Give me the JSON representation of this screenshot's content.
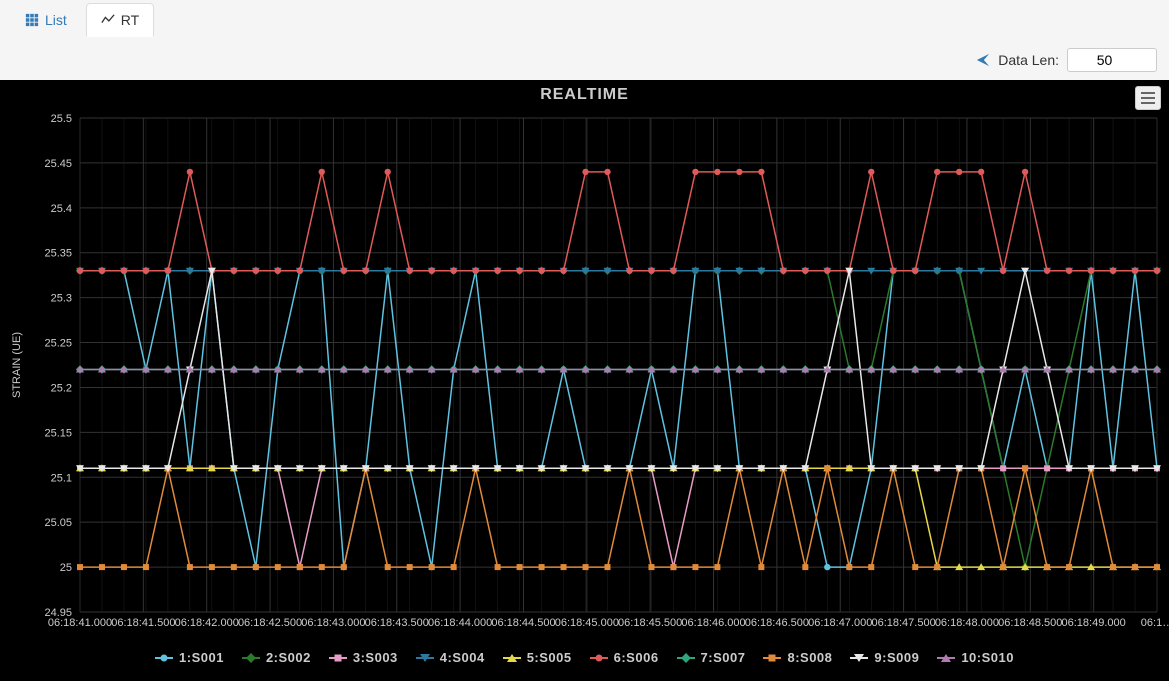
{
  "tabs": {
    "list": "List",
    "rt": "RT"
  },
  "controls": {
    "data_len_label": "Data Len:",
    "data_len_value": "50"
  },
  "chart_title": "REALTIME",
  "chart_data": {
    "type": "line",
    "title": "REALTIME",
    "ylabel": "STRAIN (UE)",
    "xlabel": "",
    "ylim": [
      24.95,
      25.5
    ],
    "yticks": [
      24.95,
      25,
      25.05,
      25.1,
      25.15,
      25.2,
      25.25,
      25.3,
      25.35,
      25.4,
      25.45,
      25.5
    ],
    "xticks": [
      "06:18:41.000",
      "06:18:41.500",
      "06:18:42.000",
      "06:18:42.500",
      "06:18:43.000",
      "06:18:43.500",
      "06:18:44.000",
      "06:18:44.500",
      "06:18:45.000",
      "06:18:45.500",
      "06:18:46.000",
      "06:18:46.500",
      "06:18:47.000",
      "06:18:47.500",
      "06:18:48.000",
      "06:18:48.500",
      "06:18:49.000",
      "06:1…"
    ],
    "x": [
      0,
      1,
      2,
      3,
      4,
      5,
      6,
      7,
      8,
      9,
      10,
      11,
      12,
      13,
      14,
      15,
      16,
      17,
      18,
      19,
      20,
      21,
      22,
      23,
      24,
      25,
      26,
      27,
      28,
      29,
      30,
      31,
      32,
      33,
      34,
      35,
      36,
      37,
      38,
      39,
      40,
      41,
      42,
      43,
      44,
      45,
      46,
      47,
      48,
      49
    ],
    "series": [
      {
        "name": "1:S001",
        "color": "#5fc3e0",
        "marker": "circle",
        "values": [
          25.33,
          25.33,
          25.33,
          25.22,
          25.33,
          25.11,
          25.33,
          25.11,
          25.0,
          25.22,
          25.33,
          25.33,
          25.0,
          25.11,
          25.33,
          25.11,
          25.0,
          25.22,
          25.33,
          25.11,
          25.11,
          25.11,
          25.22,
          25.11,
          25.11,
          25.11,
          25.22,
          25.11,
          25.33,
          25.33,
          25.11,
          25.11,
          25.11,
          25.11,
          25.0,
          25.0,
          25.11,
          25.33,
          25.33,
          25.33,
          25.33,
          25.22,
          25.11,
          25.22,
          25.11,
          25.11,
          25.33,
          25.11,
          25.33,
          25.11
        ]
      },
      {
        "name": "2:S002",
        "color": "#2a7a2a",
        "marker": "diamond",
        "values": [
          25.33,
          25.33,
          25.33,
          25.33,
          25.33,
          25.33,
          25.33,
          25.33,
          25.33,
          25.33,
          25.33,
          25.33,
          25.33,
          25.33,
          25.33,
          25.33,
          25.33,
          25.33,
          25.33,
          25.33,
          25.33,
          25.33,
          25.33,
          25.33,
          25.33,
          25.33,
          25.33,
          25.33,
          25.33,
          25.33,
          25.33,
          25.33,
          25.33,
          25.33,
          25.33,
          25.22,
          25.22,
          25.33,
          25.33,
          25.33,
          25.33,
          25.22,
          25.11,
          25.0,
          25.11,
          25.22,
          25.33,
          25.33,
          25.33,
          25.33
        ]
      },
      {
        "name": "3:S003",
        "color": "#e79bc7",
        "marker": "square",
        "values": [
          25.11,
          25.11,
          25.11,
          25.11,
          25.11,
          25.11,
          25.11,
          25.11,
          25.11,
          25.11,
          25.0,
          25.11,
          25.11,
          25.11,
          25.11,
          25.11,
          25.11,
          25.11,
          25.11,
          25.11,
          25.11,
          25.11,
          25.11,
          25.11,
          25.11,
          25.11,
          25.11,
          25.0,
          25.11,
          25.11,
          25.11,
          25.11,
          25.11,
          25.11,
          25.11,
          25.11,
          25.11,
          25.11,
          25.11,
          25.11,
          25.11,
          25.11,
          25.11,
          25.11,
          25.11,
          25.11,
          25.11,
          25.11,
          25.11,
          25.11
        ]
      },
      {
        "name": "4:S004",
        "color": "#2a7a9f",
        "marker": "tri-down",
        "values": [
          25.33,
          25.33,
          25.33,
          25.33,
          25.33,
          25.33,
          25.33,
          25.33,
          25.33,
          25.33,
          25.33,
          25.33,
          25.33,
          25.33,
          25.33,
          25.33,
          25.33,
          25.33,
          25.33,
          25.33,
          25.33,
          25.33,
          25.33,
          25.33,
          25.33,
          25.33,
          25.33,
          25.33,
          25.33,
          25.33,
          25.33,
          25.33,
          25.33,
          25.33,
          25.33,
          25.33,
          25.33,
          25.33,
          25.33,
          25.33,
          25.33,
          25.33,
          25.33,
          25.33,
          25.33,
          25.33,
          25.33,
          25.33,
          25.33,
          25.33
        ]
      },
      {
        "name": "5:S005",
        "color": "#e5d94a",
        "marker": "tri-up",
        "values": [
          25.11,
          25.11,
          25.11,
          25.11,
          25.11,
          25.11,
          25.11,
          25.11,
          25.11,
          25.11,
          25.11,
          25.11,
          25.11,
          25.11,
          25.11,
          25.11,
          25.11,
          25.11,
          25.11,
          25.11,
          25.11,
          25.11,
          25.11,
          25.11,
          25.11,
          25.11,
          25.11,
          25.11,
          25.11,
          25.11,
          25.11,
          25.11,
          25.11,
          25.11,
          25.11,
          25.11,
          25.11,
          25.11,
          25.11,
          25.0,
          25.0,
          25.0,
          25.0,
          25.0,
          25.0,
          25.0,
          25.0,
          25.0,
          25.0,
          25.0
        ]
      },
      {
        "name": "6:S006",
        "color": "#e05a5a",
        "marker": "circle",
        "values": [
          25.33,
          25.33,
          25.33,
          25.33,
          25.33,
          25.44,
          25.33,
          25.33,
          25.33,
          25.33,
          25.33,
          25.44,
          25.33,
          25.33,
          25.44,
          25.33,
          25.33,
          25.33,
          25.33,
          25.33,
          25.33,
          25.33,
          25.33,
          25.44,
          25.44,
          25.33,
          25.33,
          25.33,
          25.44,
          25.44,
          25.44,
          25.44,
          25.33,
          25.33,
          25.33,
          25.33,
          25.44,
          25.33,
          25.33,
          25.44,
          25.44,
          25.44,
          25.33,
          25.44,
          25.33,
          25.33,
          25.33,
          25.33,
          25.33,
          25.33
        ]
      },
      {
        "name": "7:S007",
        "color": "#2fa57b",
        "marker": "diamond",
        "values": [
          25.22,
          25.22,
          25.22,
          25.22,
          25.22,
          25.22,
          25.22,
          25.22,
          25.22,
          25.22,
          25.22,
          25.22,
          25.22,
          25.22,
          25.22,
          25.22,
          25.22,
          25.22,
          25.22,
          25.22,
          25.22,
          25.22,
          25.22,
          25.22,
          25.22,
          25.22,
          25.22,
          25.22,
          25.22,
          25.22,
          25.22,
          25.22,
          25.22,
          25.22,
          25.22,
          25.22,
          25.22,
          25.22,
          25.22,
          25.22,
          25.22,
          25.22,
          25.22,
          25.22,
          25.22,
          25.22,
          25.22,
          25.22,
          25.22,
          25.22
        ]
      },
      {
        "name": "8:S008",
        "color": "#e08a3a",
        "marker": "square",
        "values": [
          25.0,
          25.0,
          25.0,
          25.0,
          25.11,
          25.0,
          25.0,
          25.0,
          25.0,
          25.0,
          25.0,
          25.0,
          25.0,
          25.11,
          25.0,
          25.0,
          25.0,
          25.0,
          25.11,
          25.0,
          25.0,
          25.0,
          25.0,
          25.0,
          25.0,
          25.11,
          25.0,
          25.0,
          25.0,
          25.0,
          25.11,
          25.0,
          25.11,
          25.0,
          25.11,
          25.0,
          25.0,
          25.11,
          25.0,
          25.0,
          25.11,
          25.11,
          25.0,
          25.11,
          25.0,
          25.0,
          25.11,
          25.0,
          25.0,
          25.0
        ]
      },
      {
        "name": "9:S009",
        "color": "#e8e8e8",
        "marker": "tri-down",
        "values": [
          25.11,
          25.11,
          25.11,
          25.11,
          25.11,
          25.22,
          25.33,
          25.11,
          25.11,
          25.11,
          25.11,
          25.11,
          25.11,
          25.11,
          25.11,
          25.11,
          25.11,
          25.11,
          25.11,
          25.11,
          25.11,
          25.11,
          25.11,
          25.11,
          25.11,
          25.11,
          25.11,
          25.11,
          25.11,
          25.11,
          25.11,
          25.11,
          25.11,
          25.11,
          25.22,
          25.33,
          25.11,
          25.11,
          25.11,
          25.11,
          25.11,
          25.11,
          25.22,
          25.33,
          25.22,
          25.11,
          25.11,
          25.11,
          25.11,
          25.11
        ]
      },
      {
        "name": "10:S010",
        "color": "#b07ab0",
        "marker": "tri-up",
        "values": [
          25.22,
          25.22,
          25.22,
          25.22,
          25.22,
          25.22,
          25.22,
          25.22,
          25.22,
          25.22,
          25.22,
          25.22,
          25.22,
          25.22,
          25.22,
          25.22,
          25.22,
          25.22,
          25.22,
          25.22,
          25.22,
          25.22,
          25.22,
          25.22,
          25.22,
          25.22,
          25.22,
          25.22,
          25.22,
          25.22,
          25.22,
          25.22,
          25.22,
          25.22,
          25.22,
          25.22,
          25.22,
          25.22,
          25.22,
          25.22,
          25.22,
          25.22,
          25.22,
          25.22,
          25.22,
          25.22,
          25.22,
          25.22,
          25.22,
          25.22
        ]
      }
    ]
  }
}
